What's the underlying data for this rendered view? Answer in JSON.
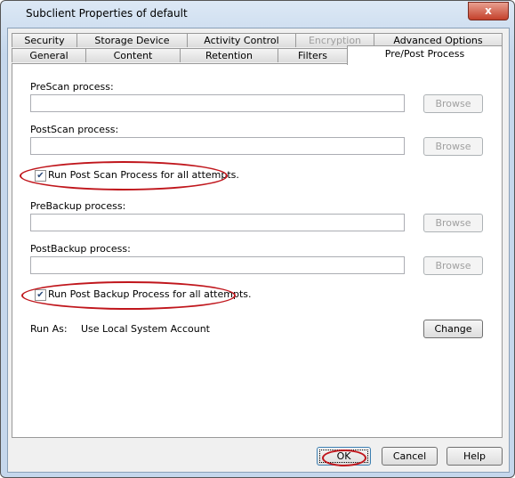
{
  "window": {
    "title": "Subclient Properties of default",
    "close": "x"
  },
  "tabs_row1": [
    {
      "label": "Security"
    },
    {
      "label": "Storage Device"
    },
    {
      "label": "Activity Control"
    },
    {
      "label": "Encryption",
      "disabled": true
    },
    {
      "label": "Advanced Options"
    }
  ],
  "tabs_row2": [
    {
      "label": "General"
    },
    {
      "label": "Content"
    },
    {
      "label": "Retention"
    },
    {
      "label": "Filters"
    },
    {
      "label": "Pre/Post Process",
      "selected": true
    }
  ],
  "form": {
    "prescan_label": "PreScan process:",
    "prescan_value": "",
    "postscan_label": "PostScan process:",
    "postscan_value": "",
    "run_post_scan_label": "Run Post Scan Process for all attempts.",
    "run_post_scan_checked": true,
    "prebackup_label": "PreBackup process:",
    "prebackup_value": "",
    "postbackup_label": "PostBackup process:",
    "postbackup_value": "",
    "run_post_backup_label": "Run Post Backup Process for all attempts.",
    "run_post_backup_checked": true,
    "browse": "Browse",
    "run_as_label": "Run As:",
    "run_as_value": "Use Local System Account",
    "change": "Change"
  },
  "buttons": {
    "ok": "OK",
    "cancel": "Cancel",
    "help": "Help"
  },
  "colors": {
    "highlight": "#c0161c"
  }
}
